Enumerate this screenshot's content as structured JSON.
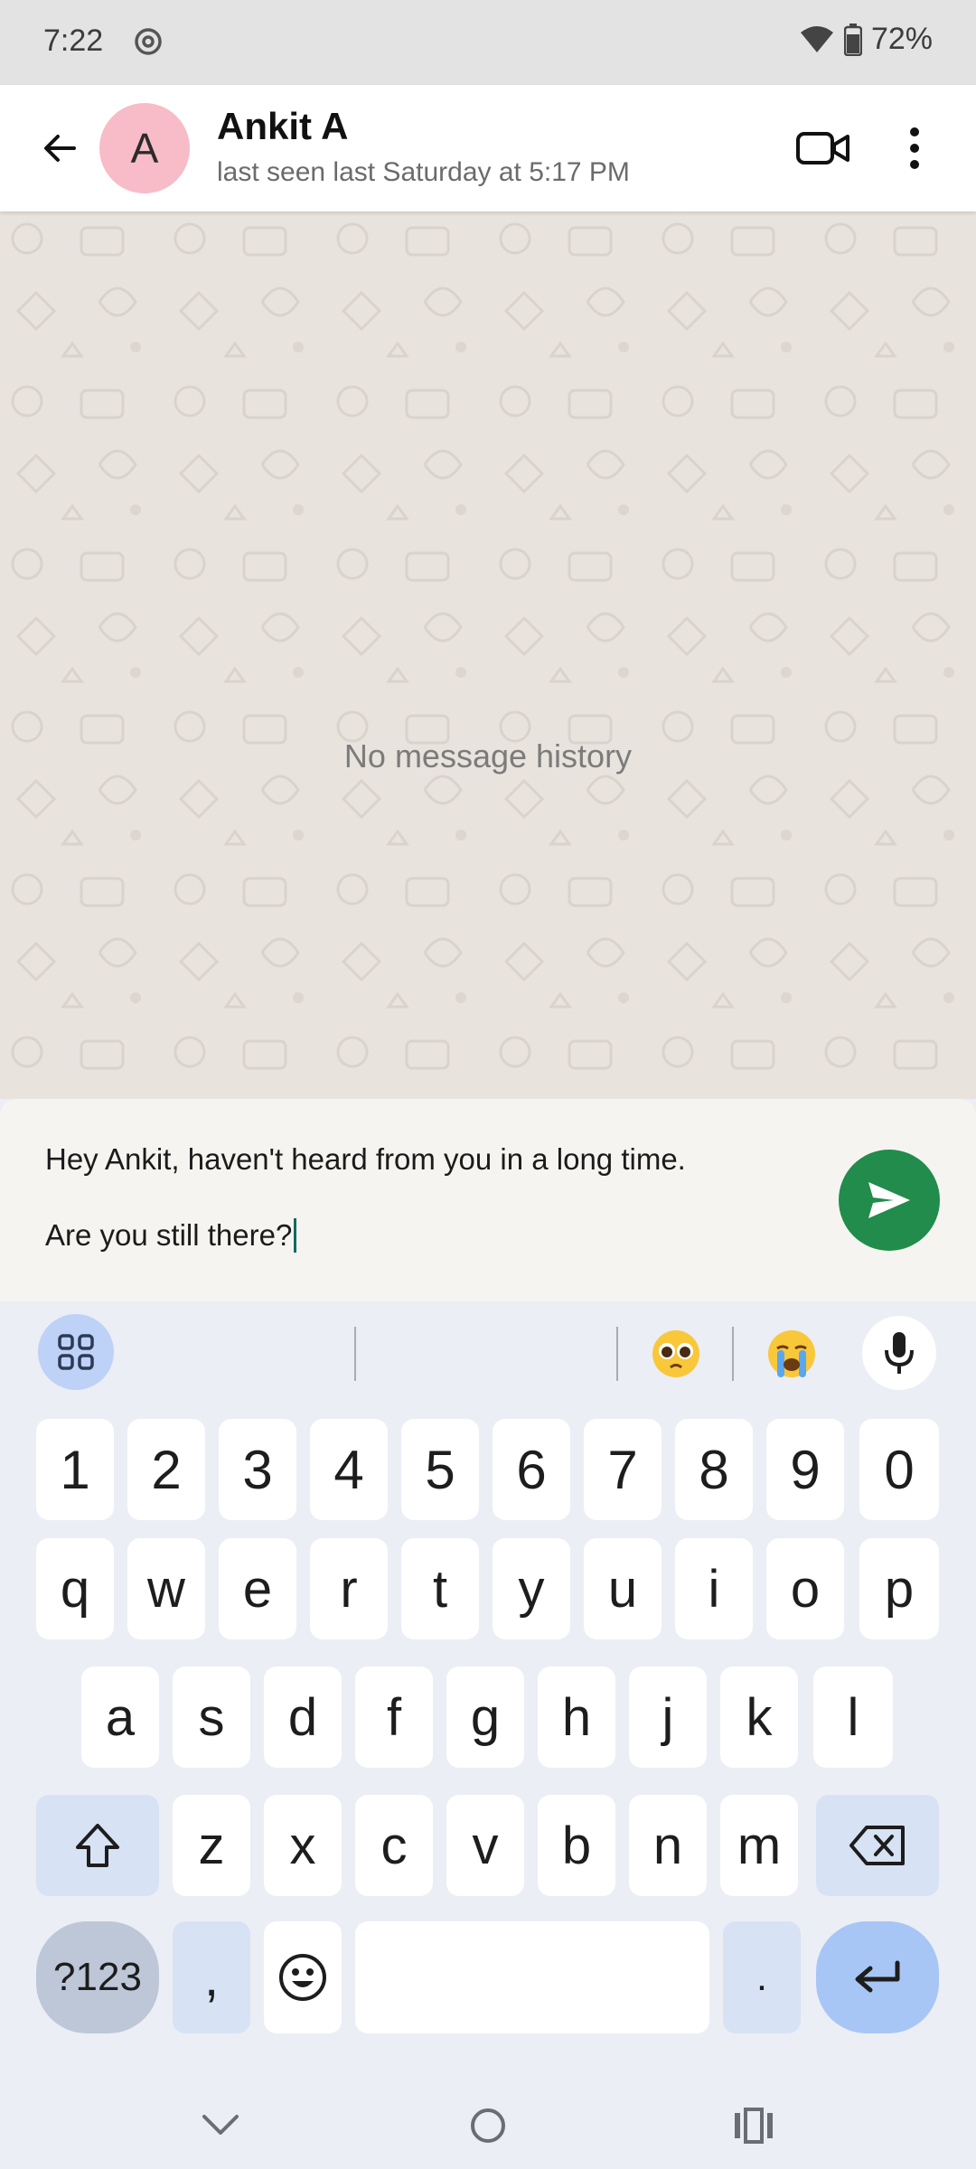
{
  "status_bar": {
    "time": "7:22",
    "battery": "72%",
    "icons": [
      "camera-ring-icon",
      "wifi-icon",
      "battery-icon"
    ]
  },
  "header": {
    "avatar_initial": "A",
    "contact_name": "Ankit A",
    "last_seen": "last seen last Saturday at 5:17 PM",
    "icons": [
      "back-arrow-icon",
      "video-call-icon",
      "more-vert-icon"
    ]
  },
  "chat": {
    "empty_message": "No message history"
  },
  "composer": {
    "text": "Hey Ankit, haven't heard from you in a long time.\n\nAre you still there?",
    "send_icon": "send-icon",
    "accent": "#218c4b"
  },
  "keyboard": {
    "toolbar_icons": [
      "apps-grid-icon",
      "pleading-face-emoji",
      "crying-face-emoji",
      "mic-icon"
    ],
    "row_numbers": [
      "1",
      "2",
      "3",
      "4",
      "5",
      "6",
      "7",
      "8",
      "9",
      "0"
    ],
    "row_top": [
      "q",
      "w",
      "e",
      "r",
      "t",
      "y",
      "u",
      "i",
      "o",
      "p"
    ],
    "row_middle": [
      "a",
      "s",
      "d",
      "f",
      "g",
      "h",
      "j",
      "k",
      "l"
    ],
    "row_bottom": [
      "z",
      "x",
      "c",
      "v",
      "b",
      "n",
      "m"
    ],
    "symbols_label": "?123",
    "comma": ",",
    "period": "."
  },
  "nav": {
    "icons": [
      "nav-back-icon",
      "nav-home-icon",
      "nav-recents-icon"
    ]
  }
}
